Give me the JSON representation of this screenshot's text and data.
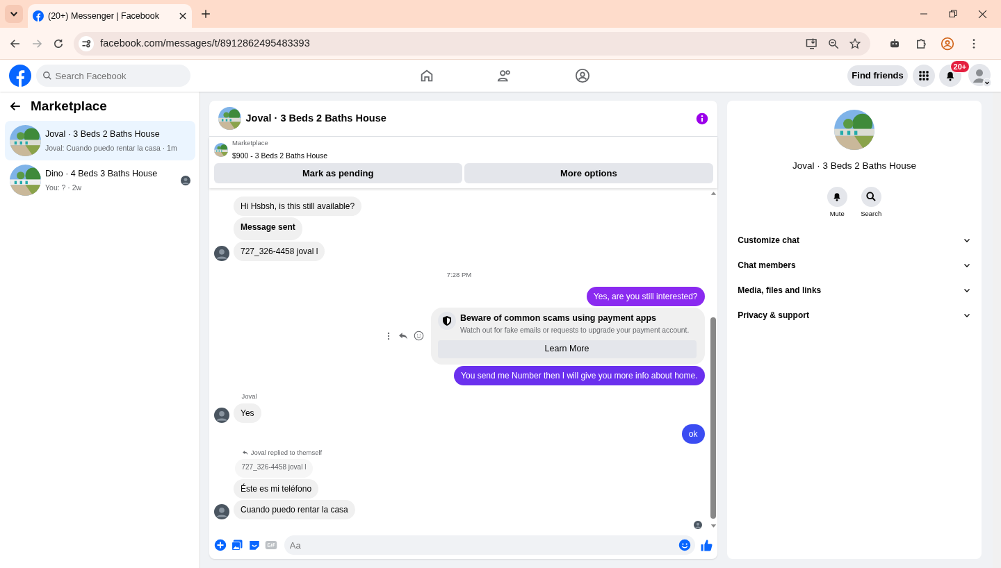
{
  "browser": {
    "tab_title": "(20+) Messenger | Facebook",
    "address": "facebook.com/messages/t/8912862495483393"
  },
  "topbar": {
    "search_placeholder": "Search Facebook",
    "find_friends": "Find friends",
    "notification_count": "20+"
  },
  "sidebar": {
    "title": "Marketplace",
    "conversations": [
      {
        "title": "Joval · 3 Beds 2 Baths House",
        "preview": "Joval: Cuando puedo rentar la casa · 1m",
        "selected": true,
        "seen": false
      },
      {
        "title": "Dino · 4 Beds 3 Baths House",
        "preview": "You: ? · 2w",
        "selected": false,
        "seen": true
      }
    ]
  },
  "chat": {
    "title": "Joval · 3 Beds 2 Baths House",
    "listing": {
      "label": "Marketplace",
      "price_title": "$900 - 3 Beds 2 Baths House"
    },
    "actions": [
      "Mark as pending",
      "More options"
    ],
    "messages": [
      {
        "kind": "incoming",
        "text": "Hi Hsbsh, is this still available?",
        "avatar": false,
        "bold": false
      },
      {
        "kind": "incoming",
        "text": "Message sent",
        "avatar": false,
        "bold": true
      },
      {
        "kind": "incoming",
        "text": "727_326-4458 joval l",
        "avatar": true,
        "bold": false
      },
      {
        "kind": "timestamp",
        "text": "7:28 PM"
      },
      {
        "kind": "outgoing",
        "text": "Yes, are you still interested?",
        "color": "#8a2af0"
      },
      {
        "kind": "notice",
        "title": "Beware of common scams using payment apps",
        "body": "Watch out for fake emails or requests to upgrade your payment account.",
        "button": "Learn More"
      },
      {
        "kind": "outgoing",
        "text": "You send me Number then I will give you more info about home.",
        "color": "#6a30ee"
      },
      {
        "kind": "sender",
        "text": "Joval"
      },
      {
        "kind": "incoming",
        "text": "Yes",
        "avatar": true,
        "bold": false
      },
      {
        "kind": "outgoing",
        "text": "ok",
        "color": "#3b4cf2"
      },
      {
        "kind": "reply_note",
        "text": "Joval replied to themself"
      },
      {
        "kind": "quoted",
        "text": "727_326-4458 joval l"
      },
      {
        "kind": "incoming",
        "text": "Éste es mi teléfono",
        "avatar": false,
        "bold": false
      },
      {
        "kind": "incoming",
        "text": "Cuando puedo rentar la casa",
        "avatar": true,
        "bold": false
      },
      {
        "kind": "seen"
      }
    ],
    "composer_placeholder": "Aa"
  },
  "details": {
    "title": "Joval · 3 Beds 2 Baths House",
    "actions": [
      {
        "label": "Mute"
      },
      {
        "label": "Search"
      }
    ],
    "sections": [
      {
        "label": "Customize chat",
        "expanded": false
      },
      {
        "label": "Chat members",
        "expanded": false
      },
      {
        "label": "Media, files and links",
        "expanded": false
      },
      {
        "label": "Privacy & support",
        "expanded": false
      }
    ]
  }
}
